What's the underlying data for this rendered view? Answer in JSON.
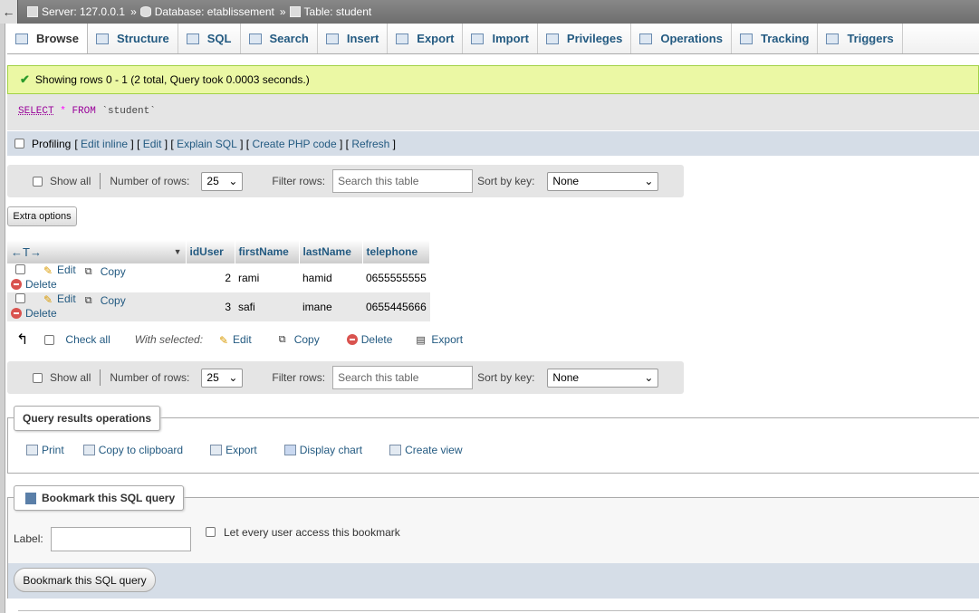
{
  "breadcrumb": {
    "back": "←",
    "server": "Server: 127.0.0.1",
    "database": "Database: etablissement",
    "table": "Table: student",
    "sep": "»"
  },
  "tabs": [
    "Browse",
    "Structure",
    "SQL",
    "Search",
    "Insert",
    "Export",
    "Import",
    "Privileges",
    "Operations",
    "Tracking",
    "Triggers"
  ],
  "message": "Showing rows 0 - 1 (2 total, Query took 0.0003 seconds.)",
  "sql": {
    "select": "SELECT",
    "star": "*",
    "from": "FROM",
    "table": "`student`"
  },
  "profiling": {
    "label": "Profiling",
    "links": [
      "Edit inline",
      "Edit",
      "Explain SQL",
      "Create PHP code",
      "Refresh"
    ]
  },
  "nav": {
    "show_all": "Show all",
    "rows_label": "Number of rows:",
    "rows_value": "25",
    "filter_label": "Filter rows:",
    "filter_placeholder": "Search this table",
    "sort_label": "Sort by key:",
    "sort_value": "None"
  },
  "extra_options": "Extra options",
  "table": {
    "arrows": "←T→",
    "columns": [
      "idUser",
      "firstName",
      "lastName",
      "telephone"
    ],
    "row_actions": {
      "edit": "Edit",
      "copy": "Copy",
      "delete": "Delete"
    },
    "rows": [
      {
        "idUser": "2",
        "firstName": "rami",
        "lastName": "hamid",
        "telephone": "0655555555"
      },
      {
        "idUser": "3",
        "firstName": "safi",
        "lastName": "imane",
        "telephone": "0655445666"
      }
    ]
  },
  "with_selected": {
    "check_all": "Check all",
    "label": "With selected:",
    "edit": "Edit",
    "copy": "Copy",
    "delete": "Delete",
    "export": "Export"
  },
  "query_ops": {
    "legend": "Query results operations",
    "items": [
      "Print",
      "Copy to clipboard",
      "Export",
      "Display chart",
      "Create view"
    ]
  },
  "bookmark": {
    "legend": "Bookmark this SQL query",
    "label": "Label:",
    "access": "Let every user access this bookmark",
    "button": "Bookmark this SQL query"
  }
}
